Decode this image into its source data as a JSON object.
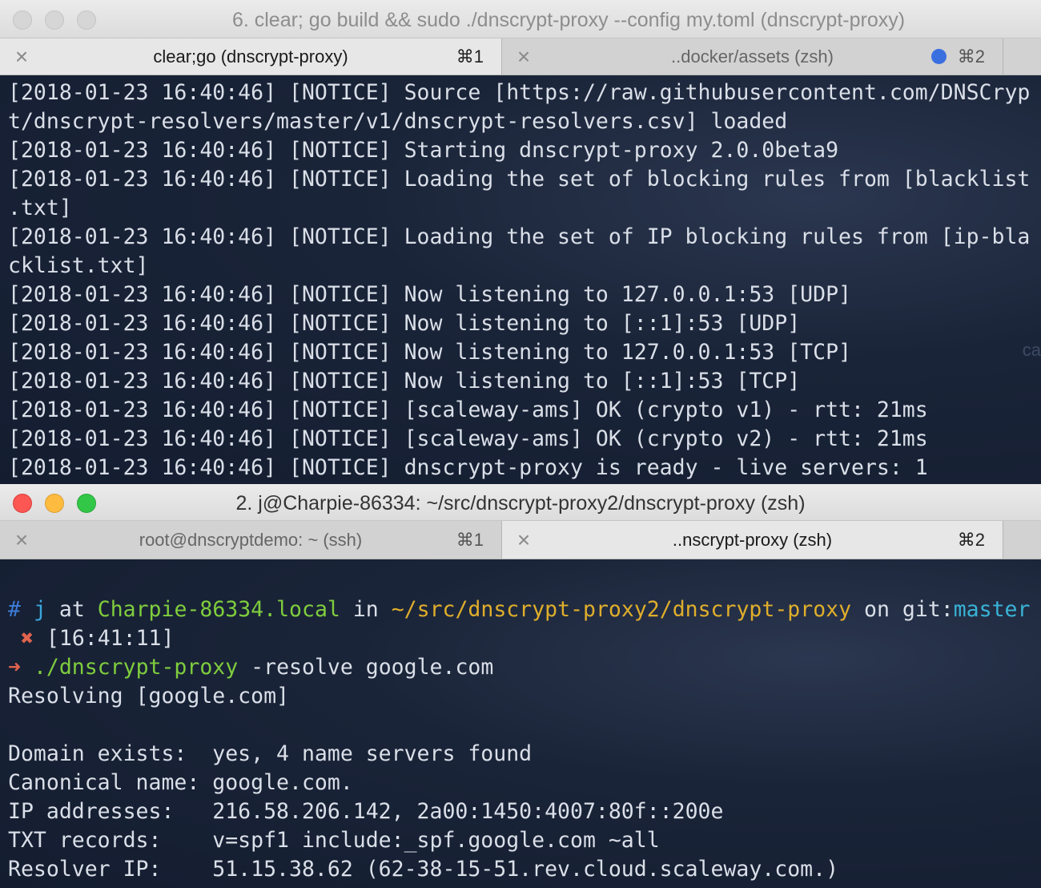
{
  "window1": {
    "title": "6. clear; go build && sudo ./dnscrypt-proxy --config my.toml (dnscrypt-proxy)",
    "tabs": [
      {
        "label": "clear;go (dnscrypt-proxy)",
        "shortcut": "⌘1",
        "active": true
      },
      {
        "label": "..docker/assets (zsh)",
        "shortcut": "⌘2",
        "active": false
      }
    ],
    "lines": [
      "[2018-01-23 16:40:46] [NOTICE] Source [https://raw.githubusercontent.com/DNSCryp",
      "t/dnscrypt-resolvers/master/v1/dnscrypt-resolvers.csv] loaded",
      "[2018-01-23 16:40:46] [NOTICE] Starting dnscrypt-proxy 2.0.0beta9",
      "[2018-01-23 16:40:46] [NOTICE] Loading the set of blocking rules from [blacklist",
      ".txt]",
      "[2018-01-23 16:40:46] [NOTICE] Loading the set of IP blocking rules from [ip-bla",
      "cklist.txt]",
      "[2018-01-23 16:40:46] [NOTICE] Now listening to 127.0.0.1:53 [UDP]",
      "[2018-01-23 16:40:46] [NOTICE] Now listening to [::1]:53 [UDP]",
      "[2018-01-23 16:40:46] [NOTICE] Now listening to 127.0.0.1:53 [TCP]",
      "[2018-01-23 16:40:46] [NOTICE] Now listening to [::1]:53 [TCP]",
      "[2018-01-23 16:40:46] [NOTICE] [scaleway-ams] OK (crypto v1) - rtt: 21ms",
      "[2018-01-23 16:40:46] [NOTICE] [scaleway-ams] OK (crypto v2) - rtt: 21ms",
      "[2018-01-23 16:40:46] [NOTICE] dnscrypt-proxy is ready - live servers: 1"
    ],
    "ghost_text": "ca"
  },
  "window2": {
    "title": "2. j@Charpie-86334: ~/src/dnscrypt-proxy2/dnscrypt-proxy (zsh)",
    "tabs": [
      {
        "label": "root@dnscryptdemo: ~ (ssh)",
        "shortcut": "⌘1",
        "active": false
      },
      {
        "label": "..nscrypt-proxy (zsh)",
        "shortcut": "⌘2",
        "active": true
      }
    ],
    "prompt": {
      "hash": "#",
      "user": "j",
      "at": " at ",
      "host": "Charpie-86334.local",
      "in": " in ",
      "path": "~/src/dnscrypt-proxy2/dnscrypt-proxy",
      "on": " on git:",
      "branch": "master",
      "x_mark": "✖",
      "time": "[16:41:11]",
      "arrow": "➜",
      "command": "./dnscrypt-proxy",
      "args": " -resolve google.com"
    },
    "output": [
      "Resolving [google.com]",
      "",
      "Domain exists:  yes, 4 name servers found",
      "Canonical name: google.com.",
      "IP addresses:   216.58.206.142, 2a00:1450:4007:80f::200e",
      "TXT records:    v=spf1 include:_spf.google.com ~all",
      "Resolver IP:    51.15.38.62 (62-38-15-51.rev.cloud.scaleway.com.)"
    ]
  },
  "colors": {
    "terminal_bg": "#1a2438",
    "host": "#7fcd3d",
    "path": "#e0ae2b",
    "user": "#39a7e0",
    "error": "#e0634e",
    "tab_indicator": "#3a6fe0"
  }
}
